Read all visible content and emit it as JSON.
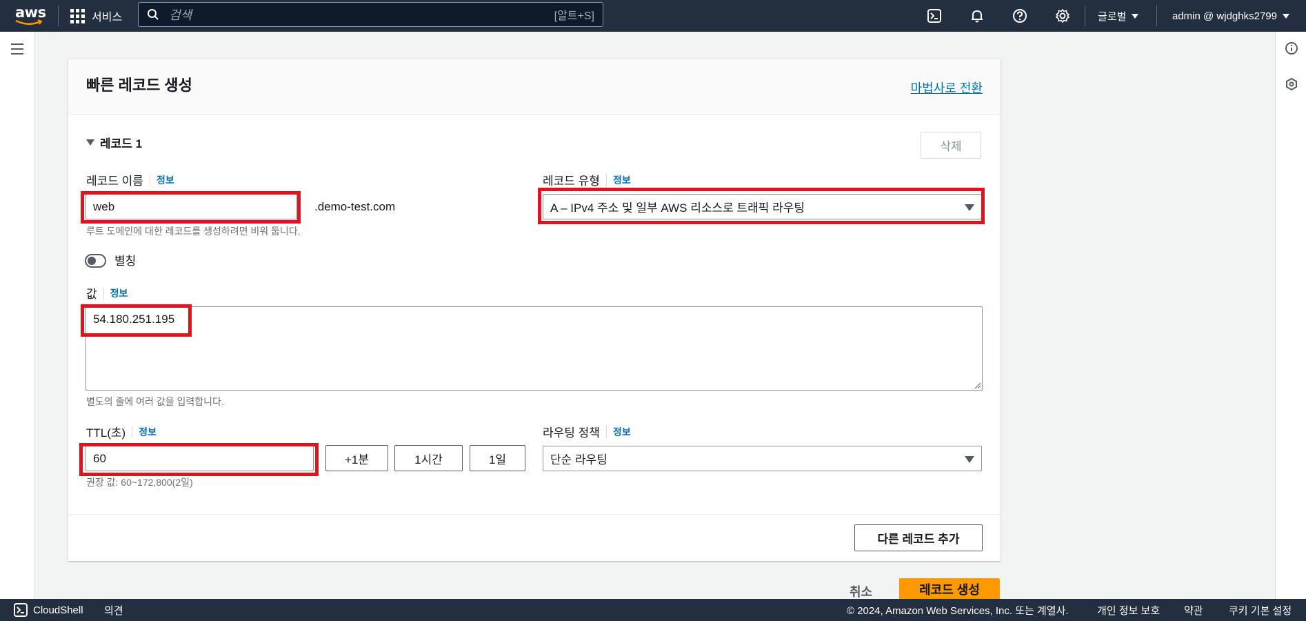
{
  "topnav": {
    "logo_text": "aws",
    "services_label": "서비스",
    "search_placeholder": "검색",
    "search_shortcut": "[알트+S]",
    "region_label": "글로벌",
    "account_label": "admin @ wjdghks2799",
    "icons": [
      "cloudshell-icon",
      "bell-icon",
      "help-icon",
      "gear-icon"
    ]
  },
  "card": {
    "title": "빠른 레코드 생성",
    "wizard_link": "마법사로 전환",
    "record_toggle_label": "레코드 1",
    "delete_button": "삭제",
    "record_name": {
      "label": "레코드 이름",
      "info": "정보",
      "value": "web",
      "suffix": ".demo-test.com",
      "hint": "루트 도메인에 대한 레코드를 생성하려면 비워 둡니다."
    },
    "record_type": {
      "label": "레코드 유형",
      "info": "정보",
      "value": "A – IPv4 주소 및 일부 AWS 리소스로 트래픽 라우팅"
    },
    "alias": {
      "label": "별칭",
      "enabled": false
    },
    "value_field": {
      "label": "값",
      "info": "정보",
      "value": "54.180.251.195",
      "hint": "별도의 줄에 여러 값을 입력합니다."
    },
    "ttl": {
      "label": "TTL(초)",
      "info": "정보",
      "value": "60",
      "hint": "권장 값: 60~172,800(2일)",
      "presets": [
        "+1분",
        "1시간",
        "1일"
      ]
    },
    "routing_policy": {
      "label": "라우팅 정책",
      "info": "정보",
      "value": "단순 라우팅"
    },
    "add_record_button": "다른 레코드 추가"
  },
  "actions": {
    "cancel": "취소",
    "create": "레코드 생성"
  },
  "footer": {
    "cloudshell": "CloudShell",
    "feedback": "의견",
    "copyright": "© 2024, Amazon Web Services, Inc. 또는 계열사.",
    "privacy": "개인 정보 보호",
    "terms": "약관",
    "cookies": "쿠키 기본 설정"
  },
  "colors": {
    "nav_bg": "#232f3e",
    "link": "#0073bb",
    "primary": "#ff9900",
    "highlight": "#e0141e"
  }
}
